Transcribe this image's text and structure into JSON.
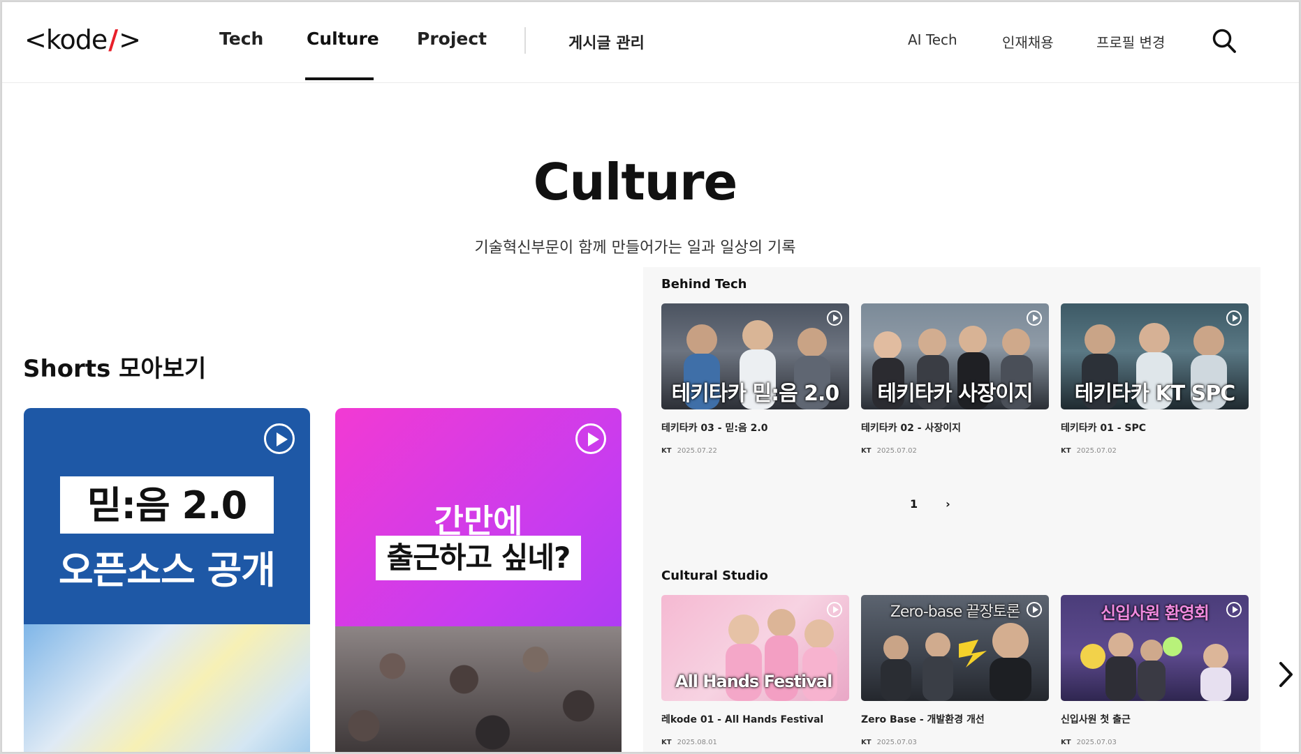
{
  "header": {
    "logo_left": "<",
    "logo_text": "kode",
    "logo_slash": "/",
    "logo_right": ">",
    "nav_main": [
      "Tech",
      "Culture",
      "Project"
    ],
    "admin_link": "게시글 관리",
    "util_links": [
      "AI Tech",
      "인재채용",
      "프로필 변경"
    ]
  },
  "hero": {
    "title": "Culture",
    "subtitle": "기술혁신부문이 함께 만들어가는 일과 일상의 기록"
  },
  "shorts": {
    "title": "Shorts 모아보기",
    "cards": [
      {
        "box_text": "믿:음 2.0",
        "line_text": "오픈소스 공개"
      },
      {
        "line_text": "간만에",
        "box_text": "출근하고 싶네?"
      }
    ]
  },
  "behind_tech": {
    "title": "Behind Tech",
    "items": [
      {
        "caption": "테키타카 믿:음 2.0",
        "title": "테키타카 03 - 믿:음 2.0",
        "author": "KT",
        "date": "2025.07.22"
      },
      {
        "caption": "테키타카 사장이지",
        "title": "테키타카 02 - 사장이지",
        "author": "KT",
        "date": "2025.07.02"
      },
      {
        "caption": "테키타카 KT SPC",
        "title": "테키타카 01 - SPC",
        "author": "KT",
        "date": "2025.07.02"
      }
    ],
    "pagination": {
      "current": "1",
      "next": "›"
    }
  },
  "cultural_studio": {
    "title": "Cultural Studio",
    "items": [
      {
        "caption": "All Hands Festival",
        "title": "레kode 01 - All Hands Festival",
        "author": "KT",
        "date": "2025.08.01"
      },
      {
        "caption": "Zero-base 끝장토론",
        "title": "Zero Base - 개발환경 개선",
        "author": "KT",
        "date": "2025.07.03"
      },
      {
        "caption": "신입사원 환영회",
        "title": "신입사원 첫 출근",
        "author": "KT",
        "date": "2025.07.03"
      }
    ]
  },
  "colors": {
    "accent_red": "#e8202a",
    "shorts_blue": "#1e58a6",
    "shorts_pink": "#e83ad8"
  }
}
